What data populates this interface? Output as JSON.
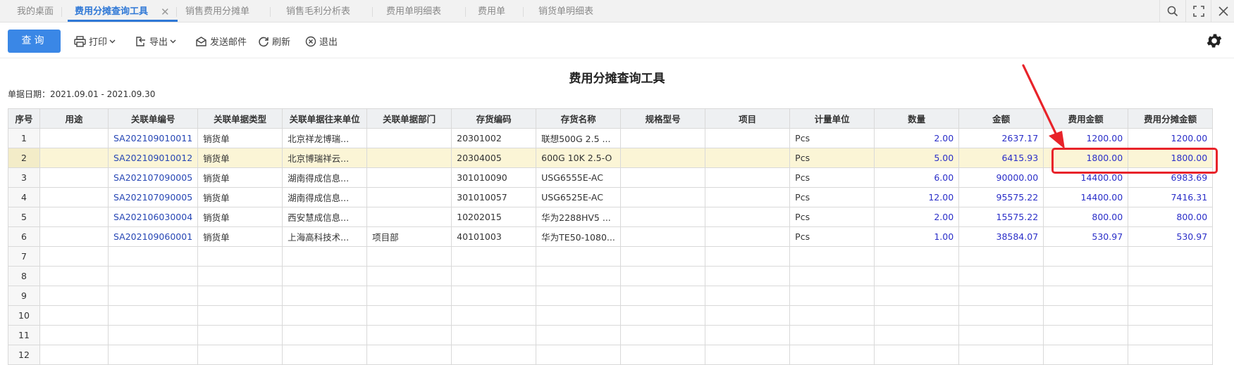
{
  "tabs": [
    {
      "label": "我的桌面"
    },
    {
      "label": "费用分摊查询工具"
    },
    {
      "label": "销售费用分摊单"
    },
    {
      "label": "销售毛利分析表"
    },
    {
      "label": "费用单明细表"
    },
    {
      "label": "费用单"
    },
    {
      "label": "销货单明细表"
    }
  ],
  "tab_close": "✕",
  "toolbar": {
    "query": "查询",
    "print": "打印",
    "export": "导出",
    "send_mail": "发送邮件",
    "refresh": "刷新",
    "exit": "退出"
  },
  "report": {
    "title": "费用分摊查询工具",
    "date_range": "单据日期：2021.09.01 - 2021.09.30"
  },
  "table": {
    "headers": [
      "序号",
      "用途",
      "关联单编号",
      "关联单据类型",
      "关联单据往来单位",
      "关联单据部门",
      "存货编码",
      "存货名称",
      "规格型号",
      "项目",
      "计量单位",
      "数量",
      "金额",
      "费用金额",
      "费用分摊金额"
    ],
    "rows": [
      [
        "1",
        "",
        "SA202109010011",
        "销货单",
        "北京祥龙博瑞...",
        "",
        "20301002",
        "联想500G 2.5 ...",
        "",
        "",
        "Pcs",
        "2.00",
        "2637.17",
        "1200.00",
        "1200.00"
      ],
      [
        "2",
        "",
        "SA202109010012",
        "销货单",
        "北京博瑞祥云...",
        "",
        "20304005",
        "600G 10K 2.5-O",
        "",
        "",
        "Pcs",
        "5.00",
        "6415.93",
        "1800.00",
        "1800.00"
      ],
      [
        "3",
        "",
        "SA202107090005",
        "销货单",
        "湖南得成信息...",
        "",
        "301010090",
        "USG6555E-AC",
        "",
        "",
        "Pcs",
        "6.00",
        "90000.00",
        "14400.00",
        "6983.69"
      ],
      [
        "4",
        "",
        "SA202107090005",
        "销货单",
        "湖南得成信息...",
        "",
        "301010057",
        "USG6525E-AC",
        "",
        "",
        "Pcs",
        "12.00",
        "95575.22",
        "14400.00",
        "7416.31"
      ],
      [
        "5",
        "",
        "SA202106030004",
        "销货单",
        "西安慧成信息...",
        "",
        "10202015",
        "华为2288HV5 ...",
        "",
        "",
        "Pcs",
        "2.00",
        "15575.22",
        "800.00",
        "800.00"
      ],
      [
        "6",
        "",
        "SA202109060001",
        "销货单",
        "上海高科技术...",
        "项目部",
        "40101003",
        "华为TE50-1080...",
        "",
        "",
        "Pcs",
        "1.00",
        "38584.07",
        "530.97",
        "530.97"
      ],
      [
        "7",
        "",
        "",
        "",
        "",
        "",
        "",
        "",
        "",
        "",
        "",
        "",
        "",
        "",
        ""
      ],
      [
        "8",
        "",
        "",
        "",
        "",
        "",
        "",
        "",
        "",
        "",
        "",
        "",
        "",
        "",
        ""
      ],
      [
        "9",
        "",
        "",
        "",
        "",
        "",
        "",
        "",
        "",
        "",
        "",
        "",
        "",
        "",
        ""
      ],
      [
        "10",
        "",
        "",
        "",
        "",
        "",
        "",
        "",
        "",
        "",
        "",
        "",
        "",
        "",
        ""
      ],
      [
        "11",
        "",
        "",
        "",
        "",
        "",
        "",
        "",
        "",
        "",
        "",
        "",
        "",
        "",
        ""
      ],
      [
        "12",
        "",
        "",
        "",
        "",
        "",
        "",
        "",
        "",
        "",
        "",
        "",
        "",
        "",
        ""
      ]
    ],
    "selected_row": 2
  },
  "colors": {
    "accent": "#3a87e6",
    "active_tab": "#2f78d6",
    "link": "#2646b4",
    "number": "#2a2ec8",
    "selected_row": "#fbf5d6",
    "annotation": "#e8232a"
  },
  "icons": {
    "search": "search-icon",
    "fullscreen": "fullscreen-icon",
    "close": "close-icon",
    "print": "printer-icon",
    "export": "export-icon",
    "mail": "mail-icon",
    "refresh": "refresh-icon",
    "exit": "exit-icon",
    "settings": "gear-icon"
  }
}
